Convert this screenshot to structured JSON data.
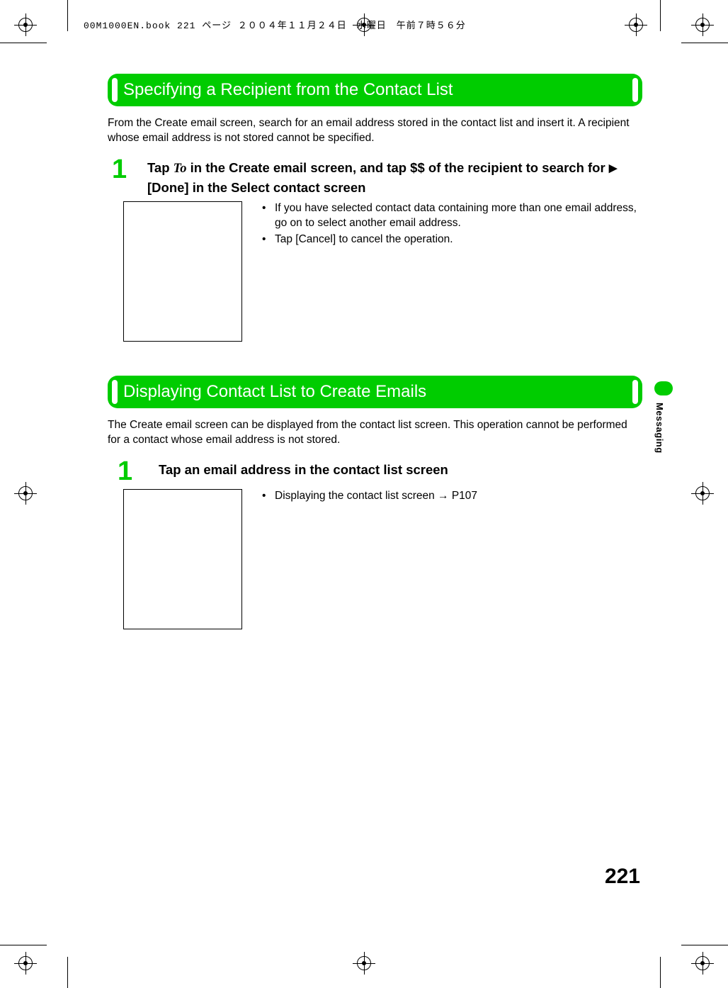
{
  "header_meta": "00M1000EN.book  221 ページ  ２００４年１１月２４日　水曜日　午前７時５６分",
  "section1": {
    "title": "Specifying a Recipient from the Contact List",
    "intro": "From the Create email screen, search for an email address stored in the contact list and insert it. A recipient whose email address is not stored cannot be specified.",
    "step_num": "1",
    "step_pre": "Tap ",
    "step_ital": "To",
    "step_mid": " in the Create email screen, and tap $$ of the recipient to search for ",
    "step_arrow": "▶",
    "step_post": " [Done] in the Select contact screen",
    "bullet1": "If you have selected contact data containing more than one email address, go on to select another email address.",
    "bullet2": "Tap [Cancel] to cancel the operation."
  },
  "section2": {
    "title": "Displaying Contact List to Create Emails",
    "intro": "The Create email screen can be displayed from the contact list screen. This operation cannot be performed for a contact whose email address is not stored.",
    "step_num": "1",
    "step_text": "Tap an email address in the contact list screen",
    "bullet1_pre": "Displaying the contact list screen ",
    "bullet1_arrow": "→",
    "bullet1_post": " P107"
  },
  "side_tab": "Messaging",
  "page_number": "221"
}
